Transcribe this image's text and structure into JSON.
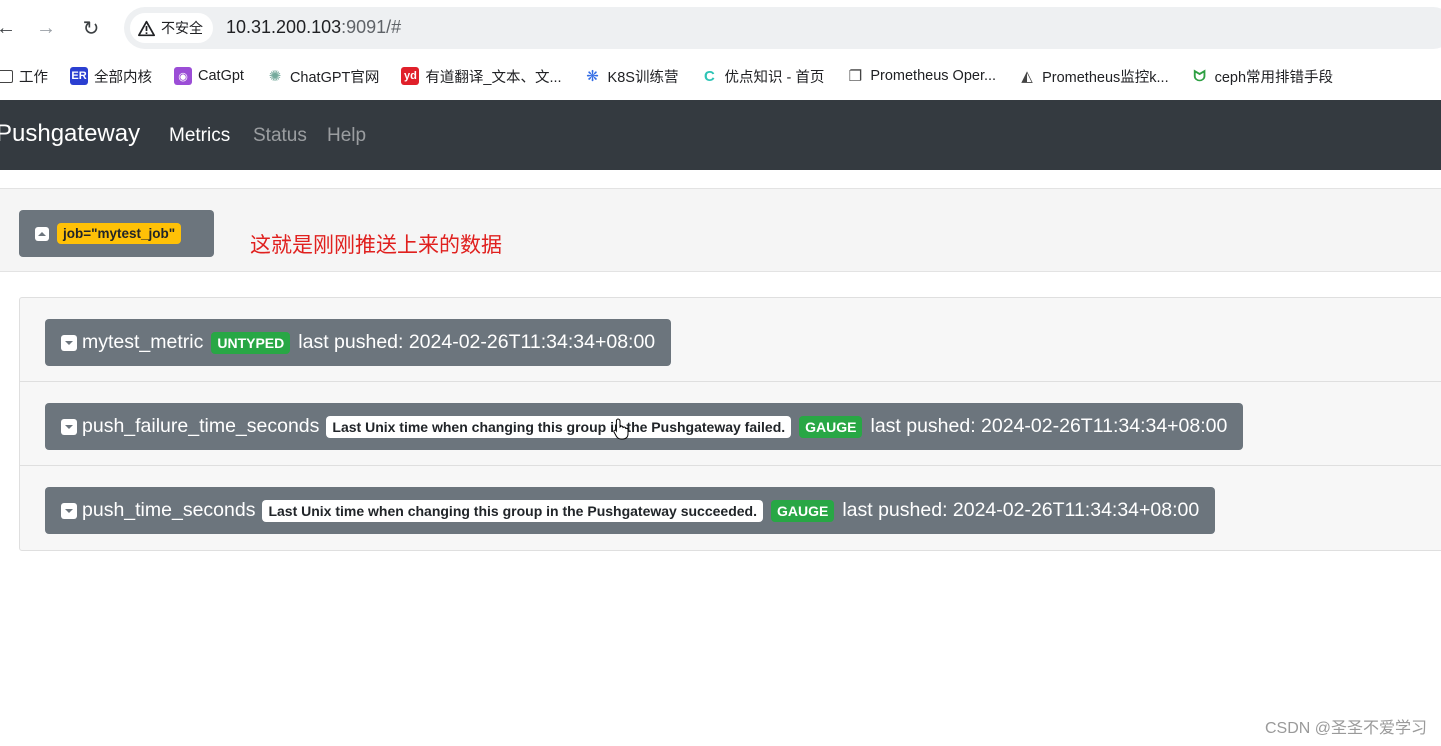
{
  "browser": {
    "security_label": "不安全",
    "url_host": "10.31.200.103",
    "url_rest": ":9091/#"
  },
  "bookmarks": [
    {
      "label": "工作",
      "icon": "folder-icon"
    },
    {
      "label": "全部内核",
      "icon": "er-icon",
      "color": "#2b3fd1"
    },
    {
      "label": "CatGpt",
      "icon": "cat-icon",
      "color": "#9b4dd6"
    },
    {
      "label": "ChatGPT官网",
      "icon": "openai-icon",
      "color": "#74aa9c"
    },
    {
      "label": "有道翻译_文本、文...",
      "icon": "youdao-icon",
      "color": "#e0202a"
    },
    {
      "label": "K8S训练营",
      "icon": "k8s-icon",
      "color": "#326ce5"
    },
    {
      "label": "优点知识 - 首页",
      "icon": "youdian-icon",
      "color": "#2ec4b6"
    },
    {
      "label": "Prometheus Oper...",
      "icon": "book-icon",
      "color": "#444444"
    },
    {
      "label": "Prometheus监控k...",
      "icon": "prom-icon",
      "color": "#444444"
    },
    {
      "label": "ceph常用排错手段",
      "icon": "ceph-icon",
      "color": "#2ea043"
    }
  ],
  "app": {
    "brand": "Pushgateway",
    "nav": {
      "metrics": "Metrics",
      "status": "Status",
      "help": "Help"
    }
  },
  "group": {
    "job_label": "job=\"mytest_job\"",
    "annotation": "这就是刚刚推送上来的数据"
  },
  "metrics": [
    {
      "name": "mytest_metric",
      "help": "",
      "type": "UNTYPED",
      "pushed": "last pushed: 2024-02-26T11:34:34+08:00"
    },
    {
      "name": "push_failure_time_seconds",
      "help": "Last Unix time when changing this group in the Pushgateway failed.",
      "type": "GAUGE",
      "pushed": "last pushed: 2024-02-26T11:34:34+08:00"
    },
    {
      "name": "push_time_seconds",
      "help": "Last Unix time when changing this group in the Pushgateway succeeded.",
      "type": "GAUGE",
      "pushed": "last pushed: 2024-02-26T11:34:34+08:00"
    }
  ],
  "watermark": "CSDN @圣圣不爱学习",
  "colors": {
    "navbar": "#343a40",
    "job_badge": "#ffc107",
    "type_badge": "#28a745",
    "annotation": "#e0201e"
  }
}
